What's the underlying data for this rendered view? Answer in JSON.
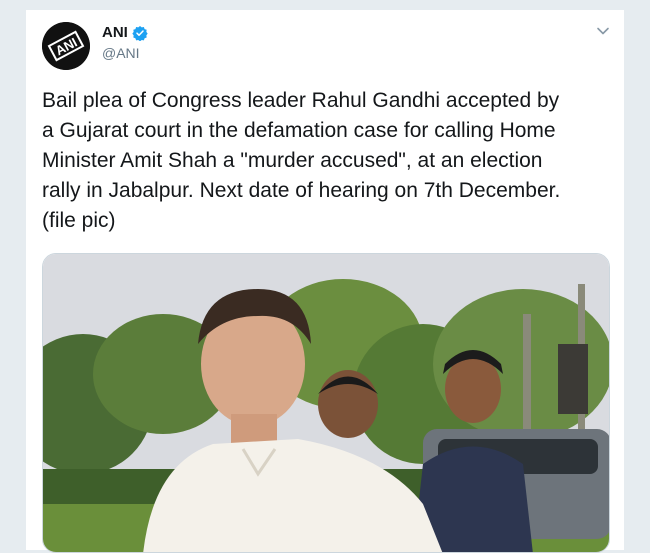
{
  "tweet": {
    "author": {
      "display_name": "ANI",
      "handle": "@ANI",
      "verified": true,
      "avatar_icon": "ani-logo-icon",
      "avatar_logo_text": "ANI"
    },
    "text": "Bail plea of Congress leader Rahul Gandhi accepted by\na Gujarat court in the defamation case for calling Home\nMinister Amit Shah a \"murder accused\", at an election\nrally in Jabalpur. Next date of hearing on 7th December.\n(file pic)",
    "menu_icon": "chevron-down-icon",
    "media": {
      "type": "photo",
      "icon": "photo-icon"
    }
  },
  "colors": {
    "page_background": "#e6ecf0",
    "card_background": "#ffffff",
    "verified_blue": "#1da1f2",
    "text_primary": "#14171a",
    "text_secondary": "#657786"
  }
}
